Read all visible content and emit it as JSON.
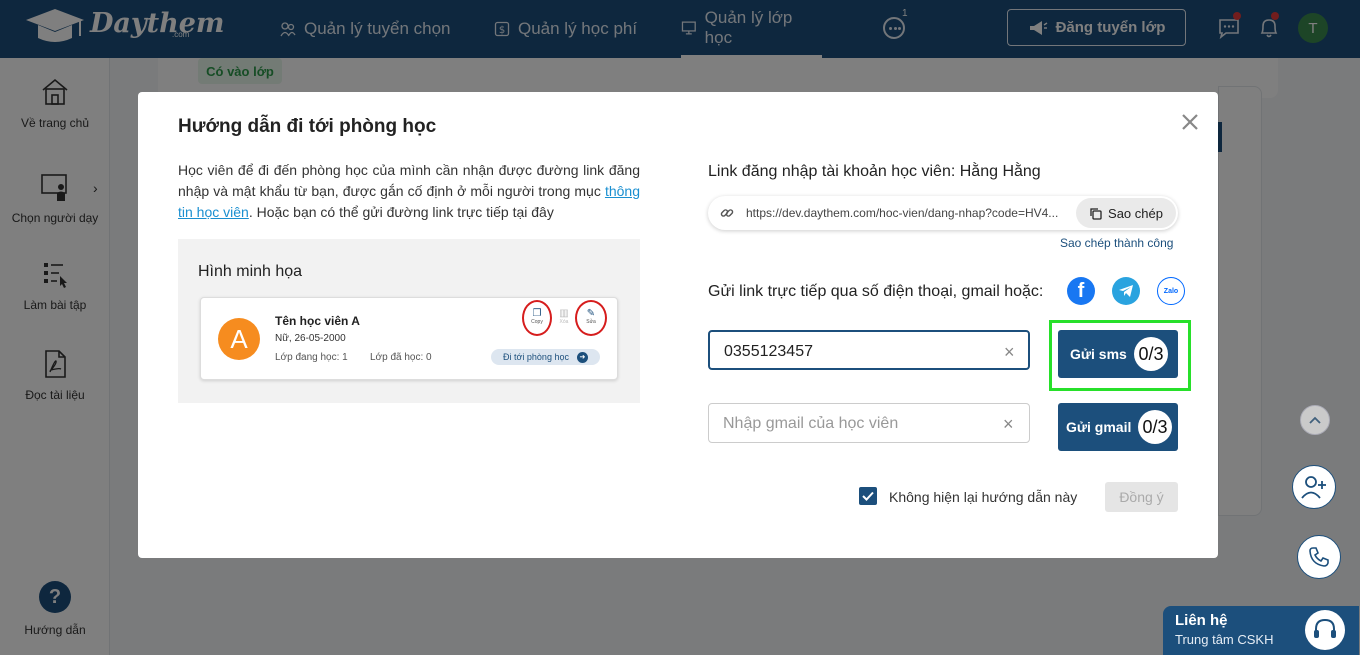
{
  "brand": {
    "name": "Daythem",
    "sub": ".com"
  },
  "nav": [
    {
      "label": "Quản lý tuyển chọn"
    },
    {
      "label": "Quản lý học phí"
    },
    {
      "label": "Quản lý lớp học"
    }
  ],
  "header": {
    "more_count": "1",
    "post_button": "Đăng tuyển lớp",
    "avatar_letter": "T"
  },
  "sidebar": {
    "items": [
      {
        "label": "Về trang chủ"
      },
      {
        "label": "Chọn người dạy"
      },
      {
        "label": "Làm bài tập"
      },
      {
        "label": "Đọc tài liệu"
      }
    ],
    "help": {
      "glyph": "?",
      "label": "Hướng dẫn"
    }
  },
  "background": {
    "chip": "Có vào lớp"
  },
  "support": {
    "title": "Liên hệ",
    "subtitle": "Trung tâm CSKH"
  },
  "modal": {
    "title": "Hướng dẫn đi tới phòng học",
    "intro_pre": "Học viên để đi đến phòng học của mình cần nhận được đường link đăng nhập và mật khẩu từ bạn, được gắn cố định ở mỗi người trong mục ",
    "intro_link": "thông tin học viên",
    "intro_post": ". Hoặc bạn có thể gửi đường link trực tiếp tại đây",
    "illustration": {
      "title": "Hình minh họa",
      "avatar": "A",
      "name": "Tên học viên A",
      "dob": "Nữ, 26-05-2000",
      "classes_current": "Lớp đang học: 1",
      "classes_done": "Lớp đã học: 0",
      "actions": [
        "Copy",
        "Xóa",
        "Sửa"
      ],
      "room_button": "Đi tới phòng học"
    },
    "login_label": "Link đăng nhập tài khoản học viên: Hằng Hằng",
    "login_url": "https://dev.daythem.com/hoc-vien/dang-nhap?code=HV4...",
    "copy_button": "Sao chép",
    "copy_status": "Sao chép thành công",
    "send_label": "Gửi link trực tiếp qua số điện thoại, gmail hoặc:",
    "social": {
      "facebook": "f",
      "zalo": "Zalo"
    },
    "phone": {
      "value": "0355123457",
      "clear": "×"
    },
    "gmail": {
      "placeholder": "Nhập gmail của học viên",
      "clear": "×"
    },
    "sms_button": {
      "label": "Gửi sms",
      "count": "0/3"
    },
    "gmail_button": {
      "label": "Gửi gmail",
      "count": "0/3"
    },
    "dont_show": "Không hiện lại hướng dẫn này",
    "agree_button": "Đồng ý"
  },
  "colors": {
    "primary": "#1c4f7c",
    "highlight": "#27e02a",
    "accent_link": "#1a8fd0"
  }
}
